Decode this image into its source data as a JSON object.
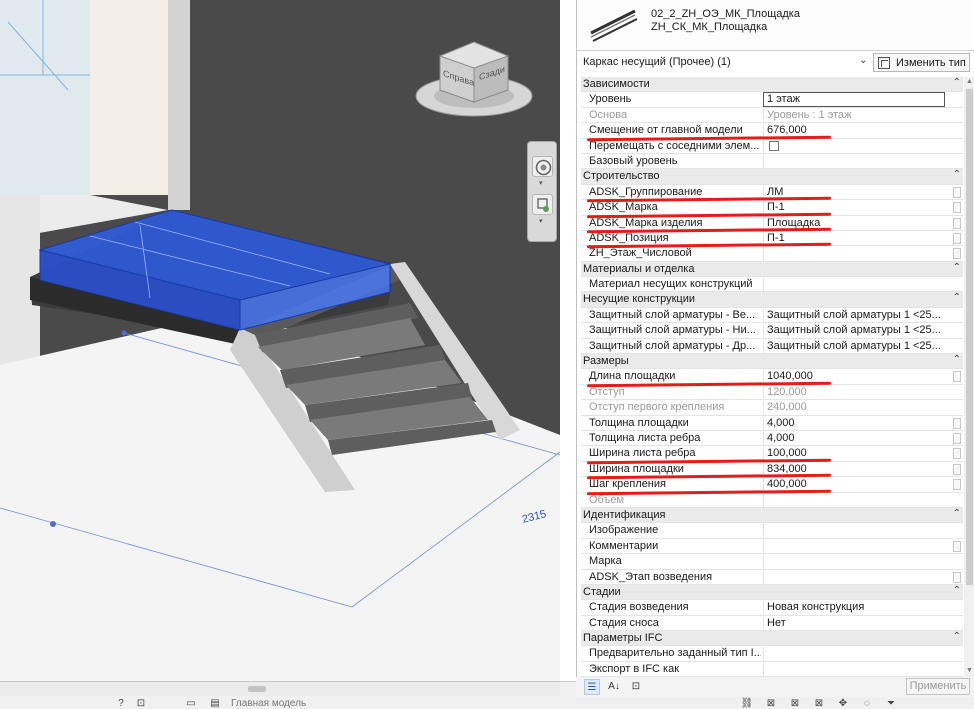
{
  "viewport": {
    "dimension_text": "2315",
    "viewcube": {
      "left_face": "Справа",
      "right_face": "Сзади"
    }
  },
  "status_bar": {
    "text": "Главная модель"
  },
  "properties": {
    "type_selector": {
      "line1": "02_2_ZH_ОЭ_МК_Площадка",
      "line2": "ZH_СК_МК_Площадка"
    },
    "filter": "Каркас несущий (Прочее) (1)",
    "edit_type_label": "Изменить тип",
    "apply_label": "Применить",
    "rows": [
      {
        "kind": "cat",
        "label": "Зависимости"
      },
      {
        "kind": "prop",
        "label": "Уровень",
        "value": "1 этаж",
        "editing": true
      },
      {
        "kind": "prop",
        "label": "Основа",
        "value": "Уровень : 1 этаж",
        "dim": true
      },
      {
        "kind": "prop",
        "label": "Смещение от главной модели",
        "value": "676,000",
        "marked": true
      },
      {
        "kind": "prop",
        "label": "Перемещать с соседними элем...",
        "checkbox": true
      },
      {
        "kind": "prop",
        "label": "Базовый уровень",
        "value": ""
      },
      {
        "kind": "cat",
        "label": "Строительство"
      },
      {
        "kind": "prop",
        "label": "ADSK_Группирование",
        "value": "ЛМ",
        "marked": true,
        "side": true
      },
      {
        "kind": "prop",
        "label": "ADSK_Марка",
        "value": "П-1",
        "marked": true,
        "side": true
      },
      {
        "kind": "prop",
        "label": "ADSK_Марка изделия",
        "value": "Площадка",
        "marked": true,
        "side": true
      },
      {
        "kind": "prop",
        "label": "ADSK_Позиция",
        "value": "П-1",
        "marked": true,
        "side": true
      },
      {
        "kind": "prop",
        "label": "ZH_Этаж_Числовой",
        "value": "",
        "side": true
      },
      {
        "kind": "cat",
        "label": "Материалы и отделка"
      },
      {
        "kind": "prop",
        "label": "Материал несущих конструкций",
        "value": ""
      },
      {
        "kind": "cat",
        "label": "Несущие конструкции"
      },
      {
        "kind": "prop",
        "label": "Защитный слой арматуры - Ве...",
        "value": "Защитный слой арматуры 1 <25..."
      },
      {
        "kind": "prop",
        "label": "Защитный слой арматуры - Ни...",
        "value": "Защитный слой арматуры 1 <25..."
      },
      {
        "kind": "prop",
        "label": "Защитный слой арматуры - Др...",
        "value": "Защитный слой арматуры 1 <25..."
      },
      {
        "kind": "cat",
        "label": "Размеры"
      },
      {
        "kind": "prop",
        "label": "Длина площадки",
        "value": "1040,000",
        "marked": true,
        "side": true
      },
      {
        "kind": "prop",
        "label": "Отступ",
        "value": "120,000",
        "dim": true
      },
      {
        "kind": "prop",
        "label": "Отступ первого крепления",
        "value": "240,000",
        "dim": true
      },
      {
        "kind": "prop",
        "label": "Толщина площадки",
        "value": "4,000",
        "side": true
      },
      {
        "kind": "prop",
        "label": "Толщина листа ребра",
        "value": "4,000",
        "side": true
      },
      {
        "kind": "prop",
        "label": "Ширина листа ребра",
        "value": "100,000",
        "marked": true,
        "side": true
      },
      {
        "kind": "prop",
        "label": "Ширина площадки",
        "value": "834,000",
        "marked": true,
        "side": true
      },
      {
        "kind": "prop",
        "label": "Шаг крепления",
        "value": "400,000",
        "marked": true,
        "side": true
      },
      {
        "kind": "prop",
        "label": "Объем",
        "value": "",
        "dim": true
      },
      {
        "kind": "cat",
        "label": "Идентификация"
      },
      {
        "kind": "prop",
        "label": "Изображение",
        "value": ""
      },
      {
        "kind": "prop",
        "label": "Комментарии",
        "value": "",
        "side": true
      },
      {
        "kind": "prop",
        "label": "Марка",
        "value": ""
      },
      {
        "kind": "prop",
        "label": "ADSK_Этап возведения",
        "value": "",
        "side": true
      },
      {
        "kind": "cat",
        "label": "Стадии"
      },
      {
        "kind": "prop",
        "label": "Стадия возведения",
        "value": "Новая конструкция"
      },
      {
        "kind": "prop",
        "label": "Стадия сноса",
        "value": "Нет"
      },
      {
        "kind": "cat",
        "label": "Параметры IFC"
      },
      {
        "kind": "prop",
        "label": "Предварительно заданный тип I...",
        "value": ""
      },
      {
        "kind": "prop",
        "label": "Экспорт в IFC как",
        "value": ""
      }
    ]
  },
  "colors": {
    "selection": "#2f5ee8",
    "annotation_red": "#e41c1c",
    "viewport_bg": "#4a4a4a",
    "dimension_blue": "#2a4fc8"
  }
}
